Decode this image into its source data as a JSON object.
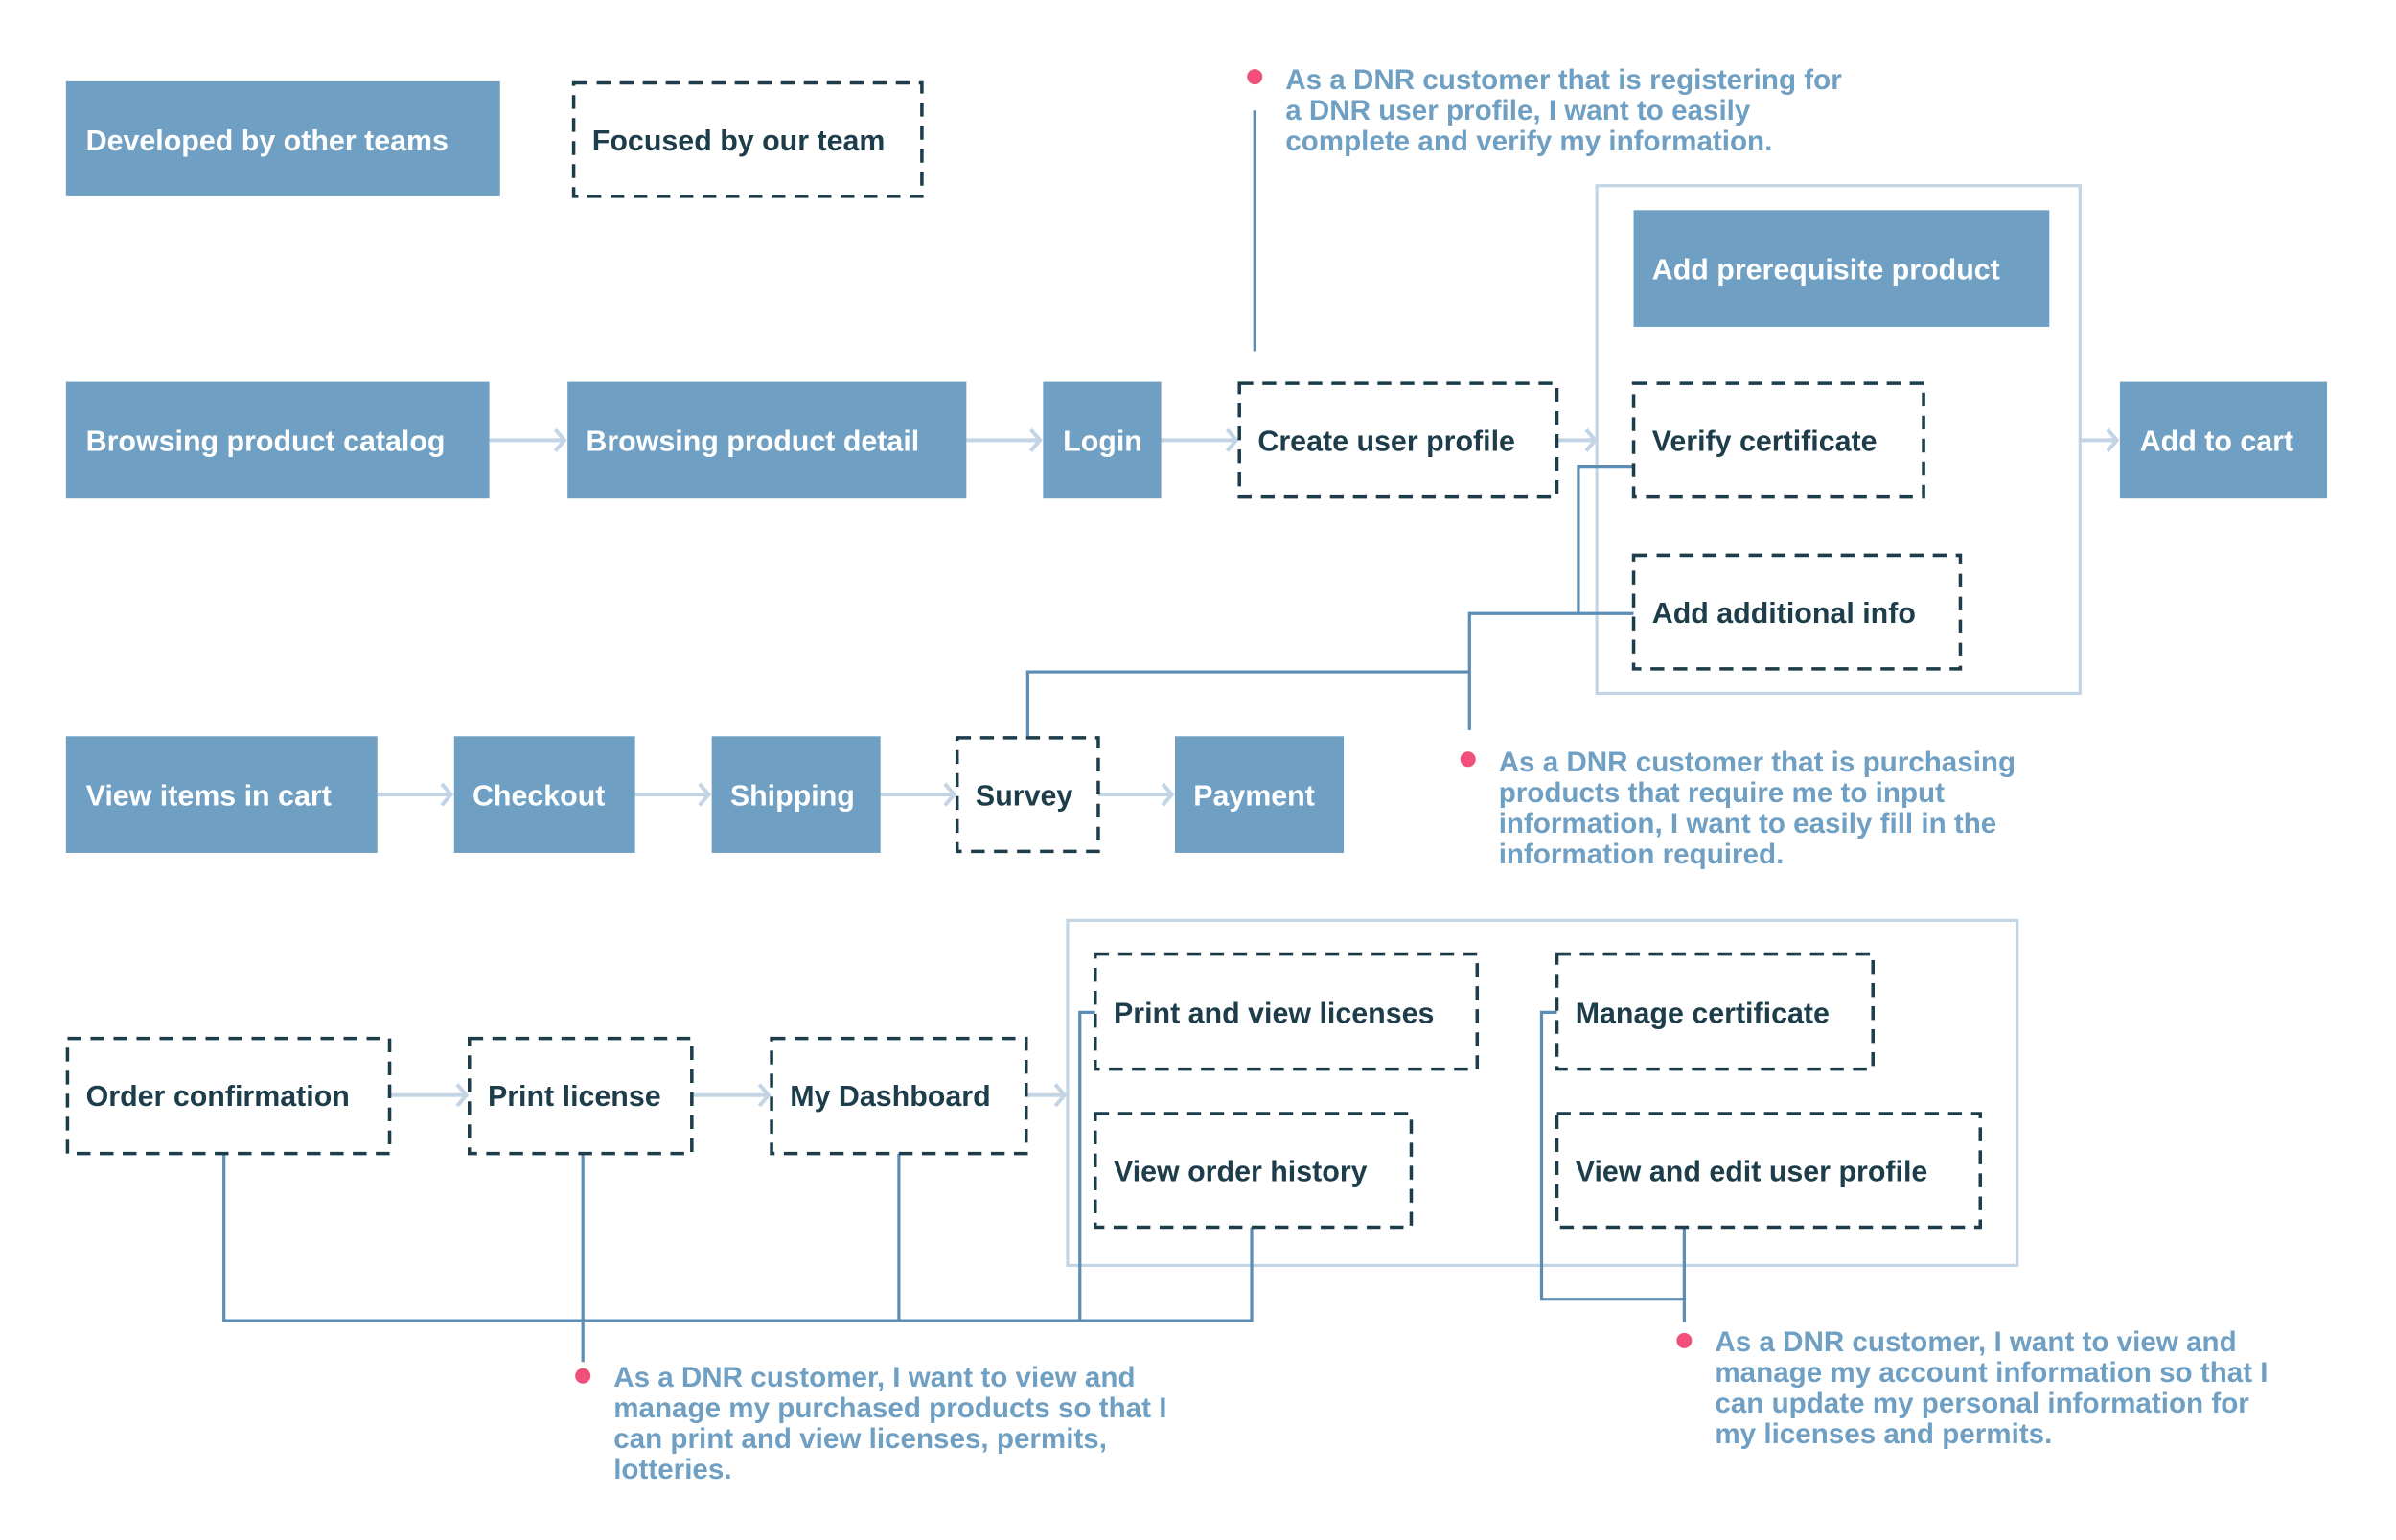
{
  "legend": {
    "developed_by_other_teams": "Developed by other teams",
    "focused_by_our_team": "Focused by our team"
  },
  "steps": {
    "browsing_catalog": "Browsing product catalog",
    "browsing_detail": "Browsing product detail",
    "login": "Login",
    "create_user_profile": "Create user profile",
    "add_prerequisite_product": "Add prerequisite product",
    "verify_certificate": "Verify certificate",
    "add_additional_info": "Add additional info",
    "add_to_cart": "Add to cart",
    "view_items_in_cart": "View items in cart",
    "checkout": "Checkout",
    "shipping": "Shipping",
    "survey": "Survey",
    "payment": "Payment",
    "order_confirmation": "Order confirmation",
    "print_license": "Print license",
    "my_dashboard": "My Dashboard",
    "print_and_view_licenses": "Print and view licenses",
    "view_order_history": "View order history",
    "manage_certificate": "Manage certificate",
    "view_and_edit_user_profile": "View and edit user profile"
  },
  "notes": {
    "registration": [
      "As a DNR customer that is registering for",
      "a DNR user profile, I want to easily",
      "complete and verify my information."
    ],
    "purchasing": [
      "As a DNR customer that is purchasing",
      "products that require me to input",
      "information, I want to easily fill in the",
      "information required."
    ],
    "purchased_products": [
      "As a DNR customer, I want to view and",
      "manage my purchased products so that I",
      "can print and view licenses, permits,",
      "lotteries."
    ],
    "account_info": [
      "As a DNR customer, I want to view and",
      "manage my account information so that I",
      "can update my personal information for",
      "my licenses and permits."
    ]
  },
  "colors": {
    "other_team_fill": "#6f9fc2",
    "our_team_border": "#1d3d4a",
    "flow_arrow": "#c3d5e4",
    "connector": "#5b8db5",
    "note_text": "#6f9fc2",
    "note_dot": "#f0507a"
  }
}
